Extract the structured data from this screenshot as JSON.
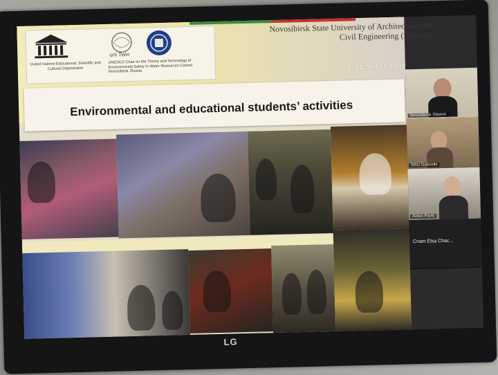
{
  "slide": {
    "unesco_caption": "United Nations Educational, Scientific and Cultural Organization",
    "unitwin_logo_text": "uni Twin",
    "chair_caption": "UNESCO Chair on the Theory and Technology of Environmental Safety in Water Resources Control Novosibirsk, Russia",
    "university_line1": "Novosibirsk State University of Architecture and",
    "university_line2": "Civil Engineering (Sibstrin)",
    "chair_label": "UNESCO Chair",
    "title": "Environmental and educational students’ activities"
  },
  "participants": [
    {
      "label": "Novosibirsk Sibstrin"
    },
    {
      "label": "NSU Gabrielle"
    },
    {
      "label": "Anton Pavlo"
    },
    {
      "label": "Cnam Elsa Chac..."
    }
  ],
  "monitor": {
    "brand": "LG"
  },
  "colors": {
    "slide_yellow": "#efe6a8",
    "title_band": "#f7f3ea",
    "bezel": "#151515"
  }
}
